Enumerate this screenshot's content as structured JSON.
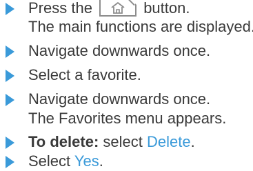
{
  "steps": [
    {
      "before": "Press the",
      "after": "button.",
      "result": "The main functions are displayed.",
      "icon": "home-icon"
    },
    {
      "text": "Navigate downwards once."
    },
    {
      "text": "Select a favorite."
    },
    {
      "text": "Navigate downwards once.",
      "result": "The Favorites menu appears."
    },
    {
      "prefix": "To delete:",
      "text": "select",
      "link": "Delete",
      "suffix": "."
    },
    {
      "text": "Select",
      "link": "Yes",
      "suffix": "."
    }
  ],
  "colors": {
    "accent": "#3a9ad9",
    "text": "#3a3a3a",
    "button_border": "#8c8c8c"
  }
}
